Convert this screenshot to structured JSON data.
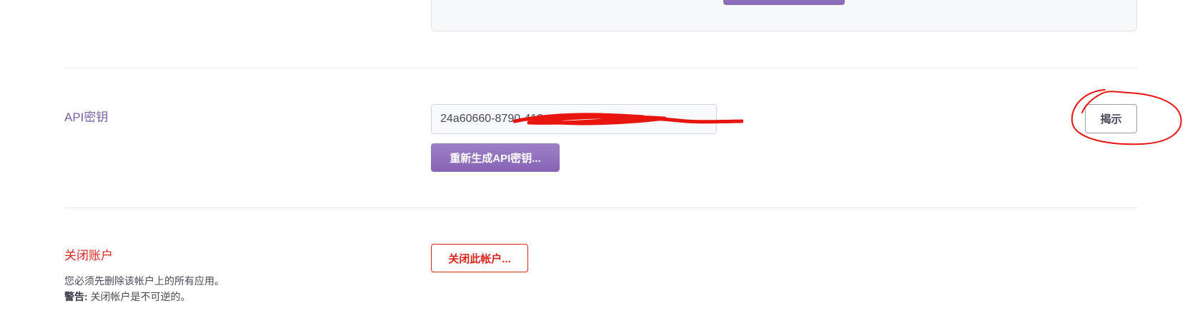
{
  "api_key": {
    "label": "API密钥",
    "value": "24a60660-8790-412",
    "regenerate_label": "重新生成API密钥...",
    "reveal_label": "揭示"
  },
  "close_account": {
    "label": "关闭账户",
    "desc_line1": "您必须先删除该帐户上的所有应用。",
    "warning_prefix": "警告:",
    "warning_text": " 关闭帐户是不可逆的。",
    "button_label": "关闭此帐户..."
  },
  "colors": {
    "accent": "#8a68b8",
    "danger": "#d9271e",
    "annotation": "#e8150f"
  }
}
